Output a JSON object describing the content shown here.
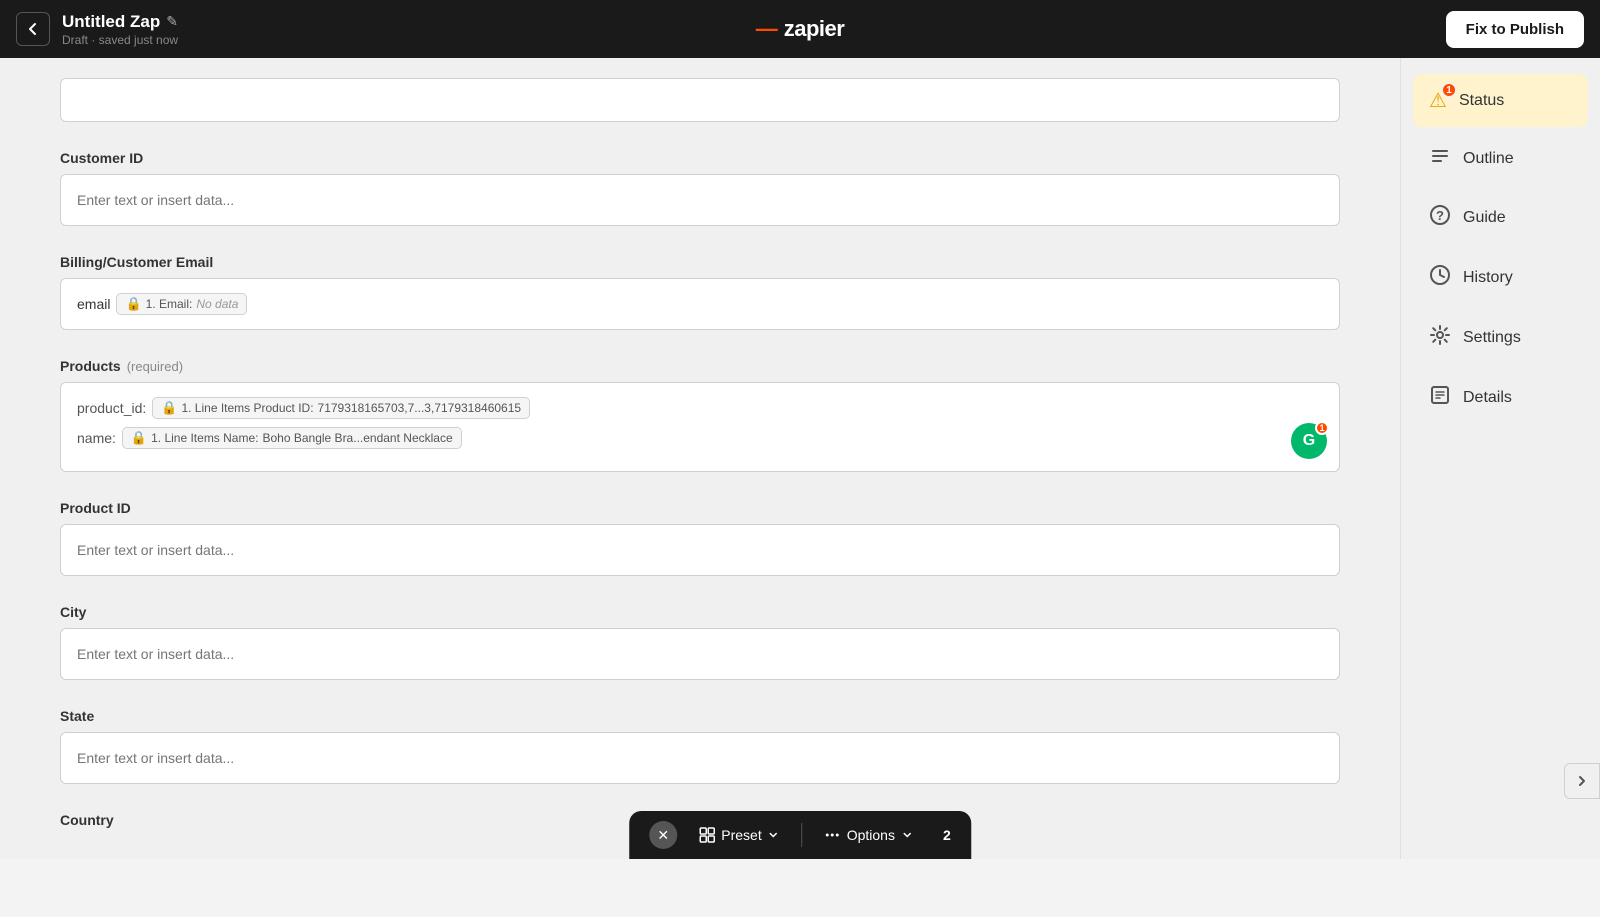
{
  "header": {
    "zap_name": "Untitled Zap",
    "draft_status": "Draft · saved just now",
    "fix_to_publish": "Fix to Publish",
    "logo_dash": "—",
    "logo_text": "zapier"
  },
  "form": {
    "top_field_placeholder": "",
    "customer_id_label": "Customer ID",
    "customer_id_placeholder": "Enter text or insert data...",
    "billing_email_label": "Billing/Customer Email",
    "billing_email_prefix": "email",
    "billing_email_tag_icon": "🔒",
    "billing_email_tag_label": "1. Email:",
    "billing_email_tag_value": "No data",
    "products_label": "Products",
    "products_required": "(required)",
    "product_id_key": "product_id:",
    "product_id_tag_icon": "🔒",
    "product_id_tag_label": "1. Line Items Product ID:",
    "product_id_tag_value": "7179318165703,7...3,7179318460615",
    "product_name_key": "name:",
    "product_name_tag_icon": "🔒",
    "product_name_tag_label": "1. Line Items Name:",
    "product_name_tag_value": "Boho Bangle Bra...endant Necklace",
    "product_id_field_label": "Product ID",
    "product_id_placeholder": "Enter text or insert data...",
    "city_label": "City",
    "city_placeholder": "Enter text or insert data...",
    "state_label": "State",
    "state_placeholder": "Enter text or insert data...",
    "country_label": "Country"
  },
  "sidebar": {
    "items": [
      {
        "id": "status",
        "label": "Status",
        "icon": "⚠",
        "active": true,
        "notification": "1"
      },
      {
        "id": "outline",
        "label": "Outline",
        "icon": "≡",
        "active": false
      },
      {
        "id": "guide",
        "label": "Guide",
        "icon": "?",
        "active": false
      },
      {
        "id": "history",
        "label": "History",
        "icon": "◷",
        "active": false
      },
      {
        "id": "settings",
        "label": "Settings",
        "icon": "⚙",
        "active": false
      },
      {
        "id": "details",
        "label": "Details",
        "icon": "⬆",
        "active": false
      }
    ]
  },
  "toolbar": {
    "close_icon": "✕",
    "preset_label": "Preset",
    "options_label": "Options",
    "page_number": "2"
  },
  "g_badge": {
    "letter": "G",
    "notification": "1"
  }
}
